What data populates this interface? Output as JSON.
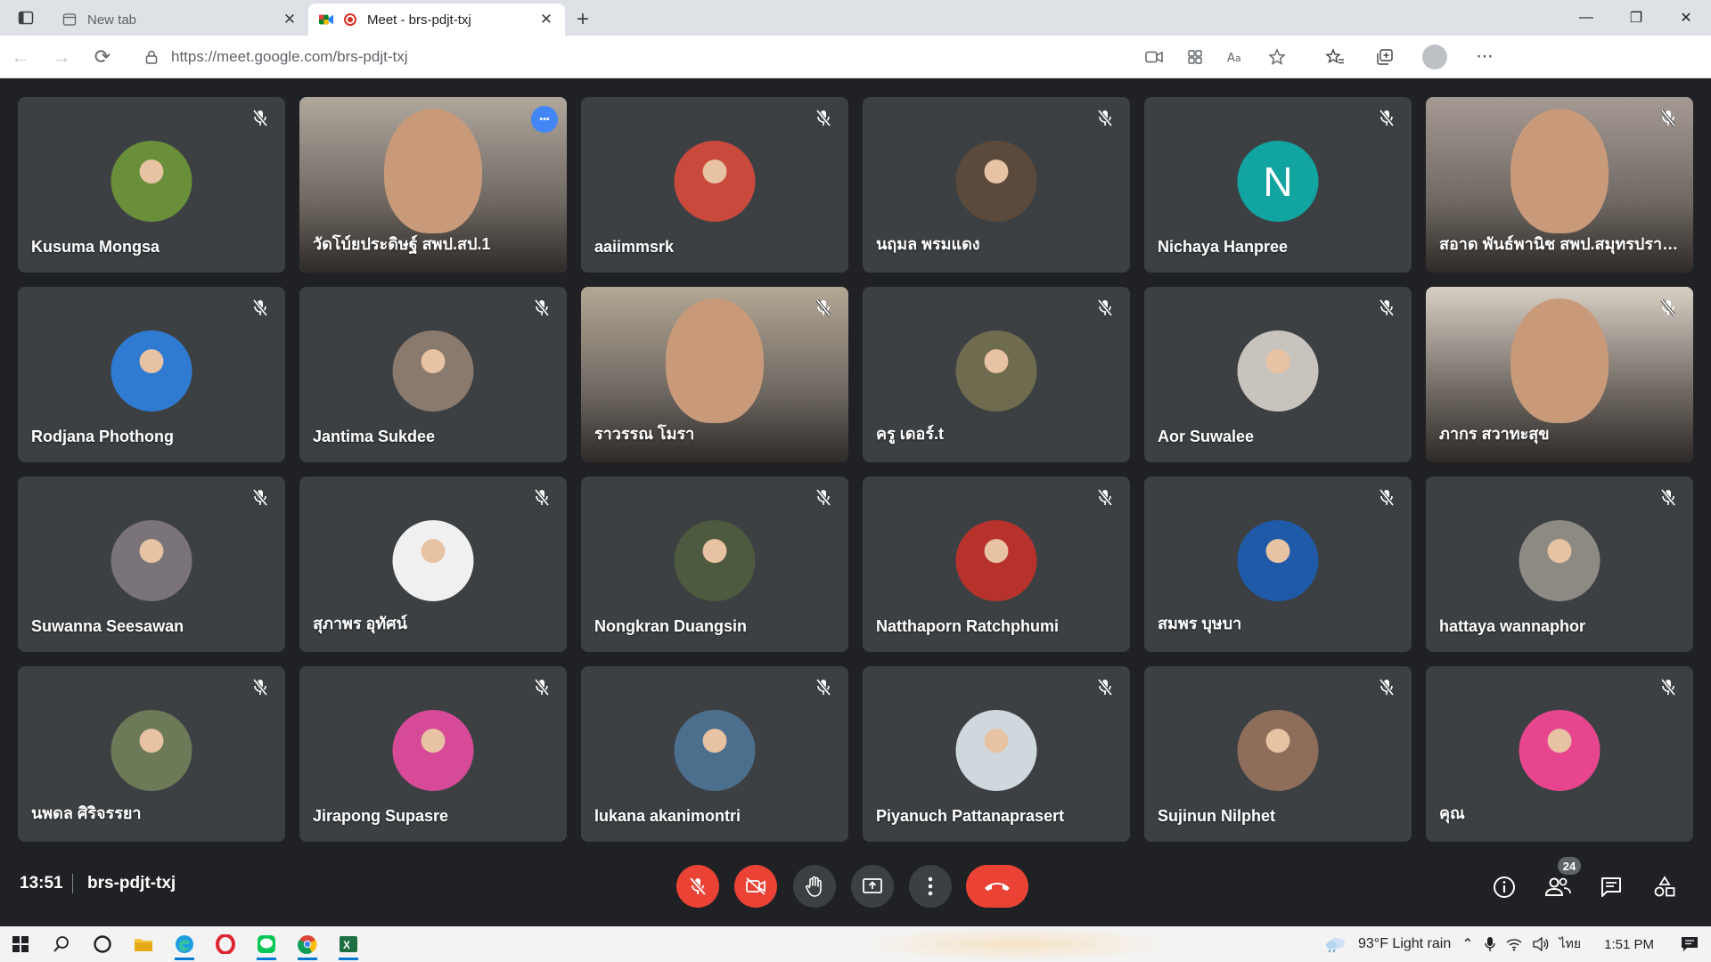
{
  "browser": {
    "tabs": [
      {
        "title": "New tab",
        "active": false
      },
      {
        "title": "Meet - brs-pdjt-txj",
        "active": true
      }
    ],
    "url": "https://meet.google.com/brs-pdjt-txj"
  },
  "meeting": {
    "time": "13:51",
    "code": "brs-pdjt-txj",
    "participant_count": "24"
  },
  "participants": [
    {
      "name": "Kusuma Mongsa",
      "kind": "photo",
      "color": "#6a8f3a"
    },
    {
      "name": "วัดโบ์ยประดิษฐ์ สพป.สป.1",
      "kind": "video",
      "color": "#b0a79c",
      "active": true
    },
    {
      "name": "aaiimmsrk",
      "kind": "photo",
      "color": "#c94a3c"
    },
    {
      "name": "นฤมล พรมแดง",
      "kind": "photo",
      "color": "#5b4a3c"
    },
    {
      "name": "Nichaya Hanpree",
      "kind": "initial",
      "initial": "N",
      "color": "#12a4a0"
    },
    {
      "name": "สอาด พันธ์พานิช สพป.สมุทรปราก...",
      "kind": "video",
      "color": "#a59a93"
    },
    {
      "name": "Rodjana Phothong",
      "kind": "photo",
      "color": "#2f7bd1"
    },
    {
      "name": "Jantima Sukdee",
      "kind": "photo",
      "color": "#8a7a6e"
    },
    {
      "name": "ราวรรณ โมรา",
      "kind": "video",
      "color": "#b3a794"
    },
    {
      "name": "ครู เดอร์.t",
      "kind": "photo",
      "color": "#6f6b4e"
    },
    {
      "name": "Aor Suwalee",
      "kind": "photo",
      "color": "#c8c3bd"
    },
    {
      "name": "ภากร สวาทะสุข",
      "kind": "video",
      "color": "#d8cfc4"
    },
    {
      "name": "Suwanna Seesawan",
      "kind": "photo",
      "color": "#7a7379"
    },
    {
      "name": "สุภาพร อุทัศน์",
      "kind": "photo",
      "color": "#f0f0f0"
    },
    {
      "name": "Nongkran Duangsin",
      "kind": "photo",
      "color": "#4d5a3f"
    },
    {
      "name": "Natthaporn Ratchphumi",
      "kind": "photo",
      "color": "#b7322d"
    },
    {
      "name": "สมพร บุษบา",
      "kind": "photo",
      "color": "#1f5aa8"
    },
    {
      "name": "hattaya wannaphor",
      "kind": "photo",
      "color": "#8d8a84"
    },
    {
      "name": "นพดล ศิริจรรยา",
      "kind": "photo",
      "color": "#6c7a58"
    },
    {
      "name": "Jirapong Supasre",
      "kind": "photo",
      "color": "#d64a97"
    },
    {
      "name": "lukana akanimontri",
      "kind": "photo",
      "color": "#4d6f8e"
    },
    {
      "name": "Piyanuch Pattanaprasert",
      "kind": "photo",
      "color": "#cfd8dd"
    },
    {
      "name": "Sujinun Nilphet",
      "kind": "photo",
      "color": "#8e6e5a"
    },
    {
      "name": "คุณ",
      "kind": "photo",
      "color": "#e7468f"
    }
  ],
  "taskbar": {
    "weather": "93°F  Light rain",
    "lang": "ไทย",
    "clock": "1:51 PM"
  }
}
